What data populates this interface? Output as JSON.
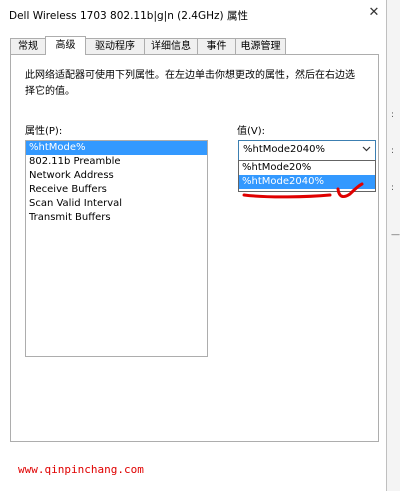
{
  "window": {
    "title": "Dell Wireless 1703 802.11b|g|n (2.4GHz) 属性",
    "close_glyph": "✕"
  },
  "tabs": [
    {
      "label": "常规",
      "active": false
    },
    {
      "label": "高级",
      "active": true
    },
    {
      "label": "驱动程序",
      "active": false
    },
    {
      "label": "详细信息",
      "active": false
    },
    {
      "label": "事件",
      "active": false
    },
    {
      "label": "电源管理",
      "active": false
    }
  ],
  "description": "此网络适配器可使用下列属性。在左边单击你想更改的属性，然后在右边选择它的值。",
  "properties": {
    "label": "属性(P):",
    "items": [
      "%htMode%",
      "802.11b Preamble",
      "Network Address",
      "Receive Buffers",
      "Scan Valid Interval",
      "Transmit Buffers"
    ],
    "selected_index": 0
  },
  "value": {
    "label": "值(V):",
    "current": "%htMode2040%",
    "options": [
      "%htMode20%",
      "%htMode2040%"
    ],
    "highlighted_index": 1
  },
  "annotation": {
    "color": "#e00000"
  },
  "watermark": {
    "text": "www.qinpinchang.com",
    "color": "#e00000"
  },
  "colors": {
    "selection": "#3399ff",
    "border": "#adadad"
  },
  "icons": {
    "dropdown": "chevron-down-icon",
    "close": "close-icon"
  }
}
